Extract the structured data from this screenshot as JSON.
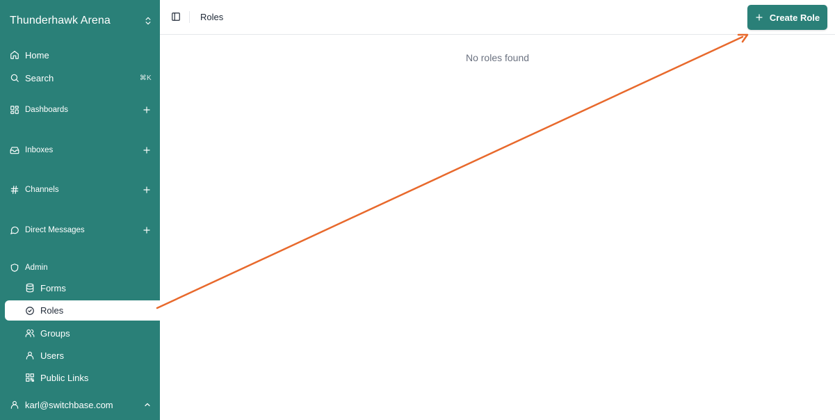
{
  "workspace": {
    "name": "Thunderhawk Arena"
  },
  "nav": {
    "home": "Home",
    "search": "Search",
    "search_shortcut": "⌘K",
    "dashboards": "Dashboards",
    "inboxes": "Inboxes",
    "channels": "Channels",
    "direct_messages": "Direct Messages",
    "admin": "Admin"
  },
  "admin_items": [
    {
      "label": "Forms",
      "icon": "database-icon"
    },
    {
      "label": "Roles",
      "icon": "badge-check-icon",
      "active": true
    },
    {
      "label": "Groups",
      "icon": "users-icon"
    },
    {
      "label": "Users",
      "icon": "user-icon"
    },
    {
      "label": "Public Links",
      "icon": "qr-code-icon"
    }
  ],
  "user": {
    "email": "karl@switchbase.com"
  },
  "header": {
    "breadcrumb": "Roles",
    "create_button": "Create Role"
  },
  "main": {
    "empty_message": "No roles found"
  },
  "colors": {
    "accent": "#2a8078",
    "annotation_arrow": "#e8692c"
  }
}
